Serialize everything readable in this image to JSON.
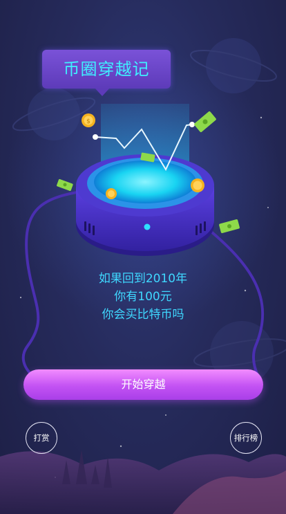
{
  "header": {
    "title": "币圈穿越记"
  },
  "prompt": {
    "line1": "如果回到2010年",
    "line2": "你有100元",
    "line3": "你会买比特币吗"
  },
  "actions": {
    "start_label": "开始穿越",
    "reward_label": "打赏",
    "rank_label": "排行榜"
  },
  "colors": {
    "title_text": "#3ff0ff",
    "prompt_text": "#3fd8ff",
    "button_pink": "#d964f7",
    "title_bubble": "#6a45c8"
  },
  "icons": [
    "coin-icon",
    "cash-bill-icon",
    "planet-icon",
    "chart-line-icon",
    "time-machine-device"
  ]
}
